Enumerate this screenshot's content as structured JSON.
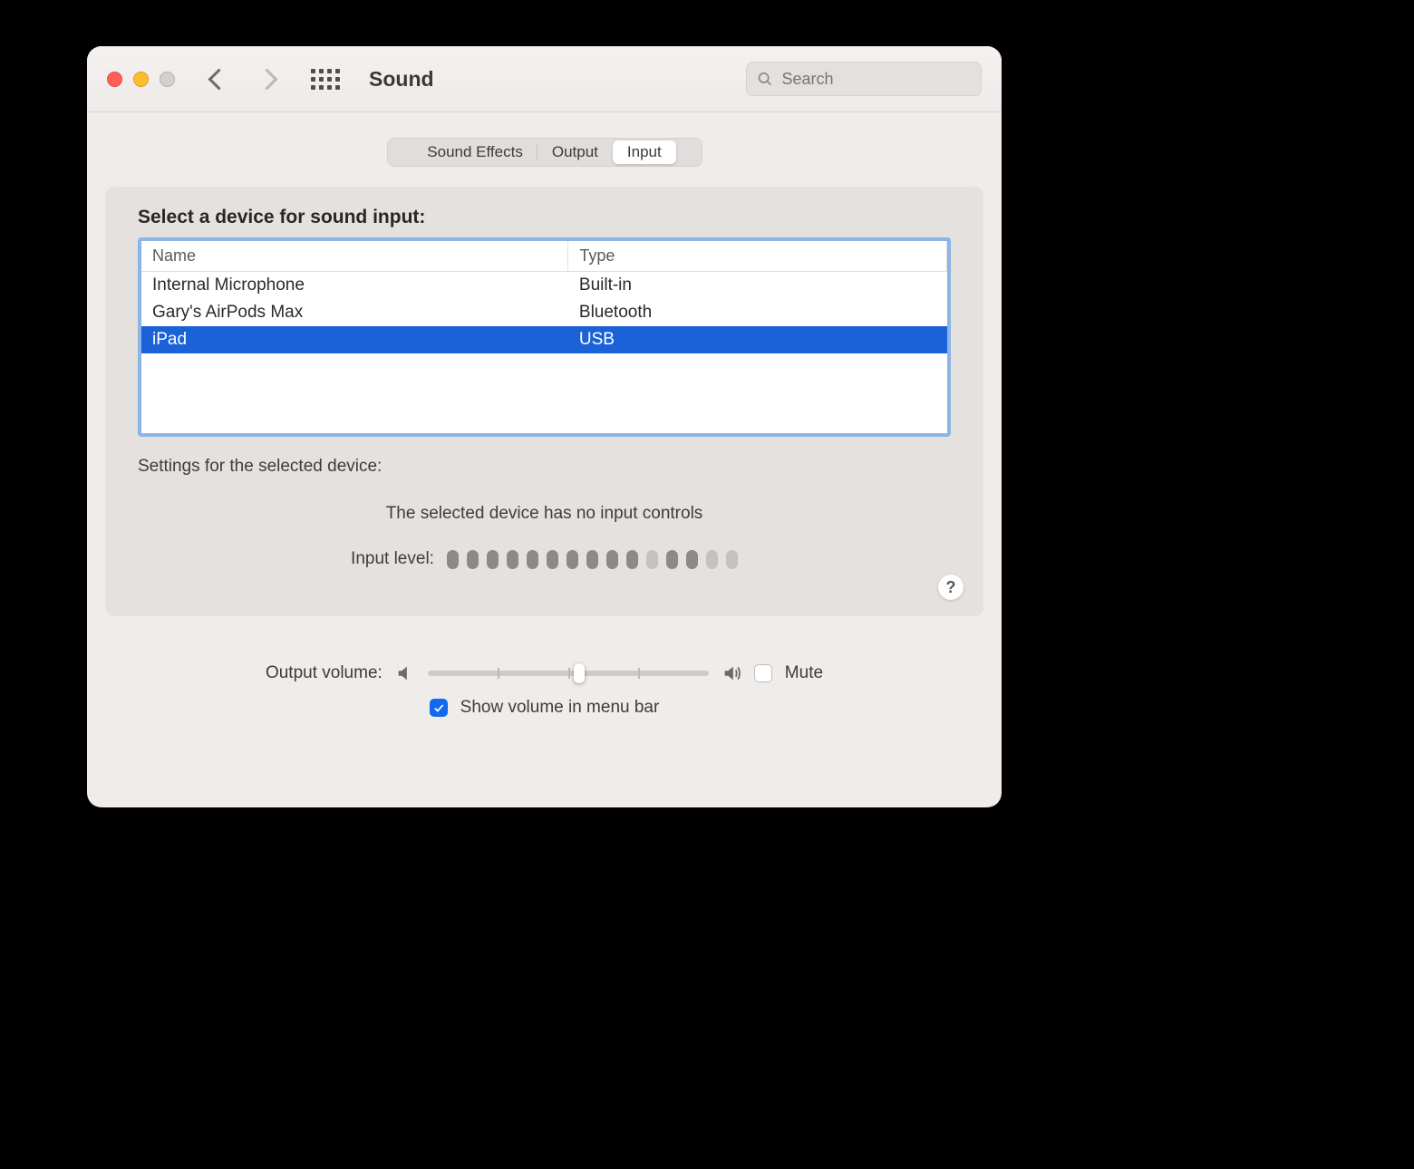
{
  "window": {
    "title": "Sound"
  },
  "search": {
    "placeholder": "Search"
  },
  "tabs": [
    "Sound Effects",
    "Output",
    "Input"
  ],
  "active_tab": 2,
  "heading": "Select a device for sound input:",
  "table": {
    "columns": [
      "Name",
      "Type"
    ],
    "rows": [
      {
        "name": "Internal Microphone",
        "type": "Built-in",
        "selected": false
      },
      {
        "name": "Gary's AirPods Max",
        "type": "Bluetooth",
        "selected": false
      },
      {
        "name": "iPad",
        "type": "USB",
        "selected": true
      }
    ]
  },
  "settings_title": "Settings for the selected device:",
  "no_controls_msg": "The selected device has no input controls",
  "input_level_label": "Input level:",
  "input_level": {
    "total": 15,
    "dim_indices": [
      10,
      13,
      14
    ]
  },
  "output": {
    "label": "Output volume:",
    "value": 0.52,
    "mute_label": "Mute",
    "mute": false
  },
  "show_in_menubar": {
    "label": "Show volume in menu bar",
    "checked": true
  }
}
